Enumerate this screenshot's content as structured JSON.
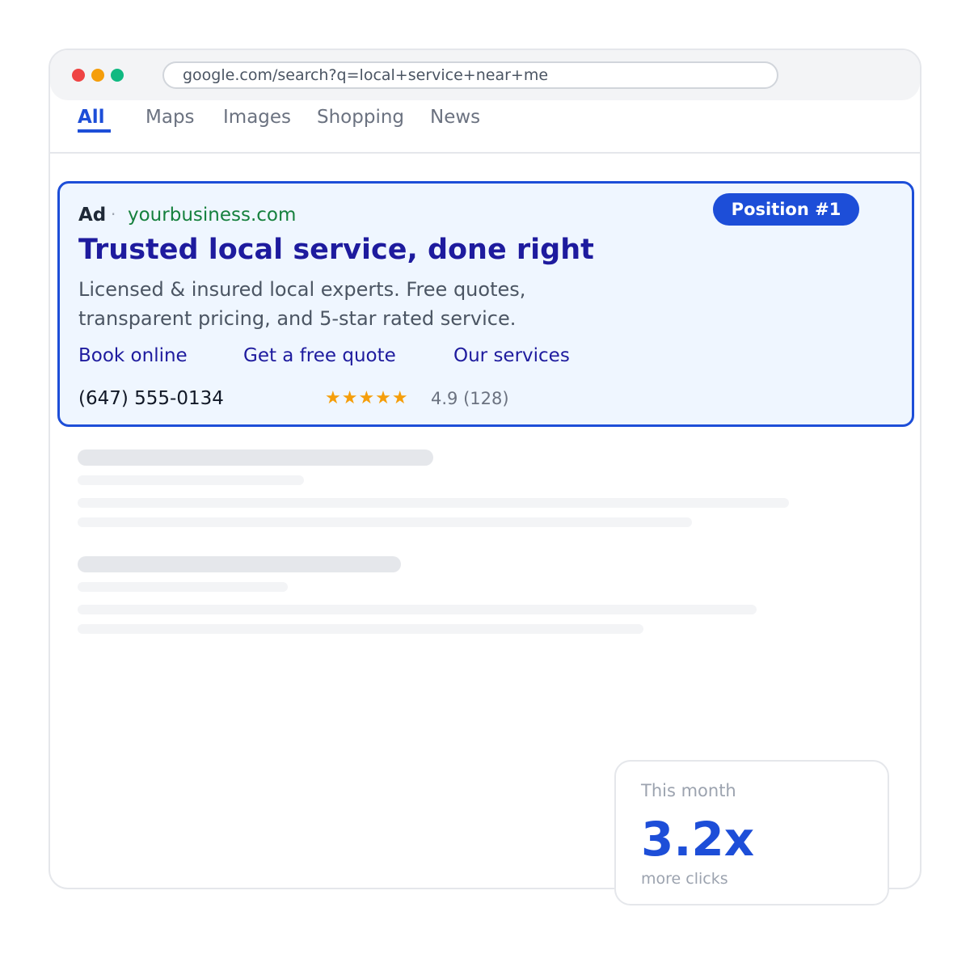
{
  "browser": {
    "url": "google.com/search?q=local+service+near+me"
  },
  "tabs": [
    {
      "label": "All",
      "active": true
    },
    {
      "label": "Maps"
    },
    {
      "label": "Images"
    },
    {
      "label": "Shopping"
    },
    {
      "label": "News"
    }
  ],
  "ad": {
    "label": "Ad",
    "separator": "·",
    "domain": "yourbusiness.com",
    "badge": "Position #1",
    "title": "Trusted local service, done right",
    "description": "Licensed & insured local experts. Free quotes, transparent pricing, and 5-star rated service.",
    "sitelinks": [
      "Book online",
      "Get a free quote",
      "Our services"
    ],
    "phone": "(647) 555-0134",
    "stars": "★★★★★",
    "rating": "4.9 (128)"
  },
  "stat": {
    "label": "This month",
    "value": "3.2x",
    "sublabel": "more clicks"
  },
  "colors": {
    "accent": "#1d4ed8",
    "ad_title": "#1e1b9e",
    "domain_green": "#15803d",
    "star": "#f59e0b"
  }
}
